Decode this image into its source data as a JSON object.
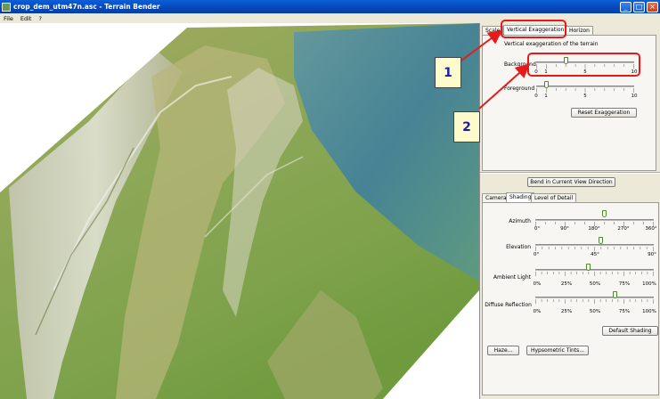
{
  "window": {
    "title": "crop_dem_utm47n.asc - Terrain Bender",
    "minimize": "_",
    "maximize": "□",
    "close": "×"
  },
  "menu": {
    "items": [
      "File",
      "Edit",
      "?"
    ]
  },
  "top_tabs": {
    "t1": "Scale",
    "t2": "Vertical Exaggeration",
    "t3": "Horizon"
  },
  "exaggeration": {
    "heading": "Vertical exaggeration of the terrain",
    "background_label": "Background",
    "background_value": 3,
    "background_ticks": [
      "0",
      "1",
      "5",
      "10"
    ],
    "foreground_label": "Foreground",
    "foreground_value": 1,
    "foreground_ticks": [
      "0",
      "1",
      "5",
      "10"
    ],
    "reset_button": "Reset Exaggeration"
  },
  "bend_button": "Bend in Current View Direction",
  "bottom_tabs": {
    "camera": "Camera",
    "shading": "Shading",
    "lod": "Level of Detail"
  },
  "shading": {
    "azimuth": {
      "label": "Azimuth",
      "value": 0.58,
      "ticks": [
        "0°",
        "90°",
        "180°",
        "270°",
        "360°"
      ]
    },
    "elevation": {
      "label": "Elevation",
      "value": 0.55,
      "ticks": [
        "0°",
        "45°",
        "90°"
      ]
    },
    "ambient": {
      "label": "Ambient Light",
      "value": 0.45,
      "ticks": [
        "0%",
        "25%",
        "50%",
        "75%",
        "100%"
      ]
    },
    "diffuse": {
      "label": "Diffuse Reflection",
      "value": 0.67,
      "ticks": [
        "0%",
        "25%",
        "50%",
        "75%",
        "100%"
      ]
    },
    "default_button": "Default Shading",
    "haze_button": "Haze...",
    "hypso_button": "Hypsometric Tints..."
  },
  "callouts": {
    "one": "1",
    "two": "2"
  },
  "colors": {
    "title_bar": "#0a5fd8",
    "annotation": "#e51b1b",
    "callout_bg": "#fdfbcc",
    "thumb": "#4b8a2b"
  }
}
